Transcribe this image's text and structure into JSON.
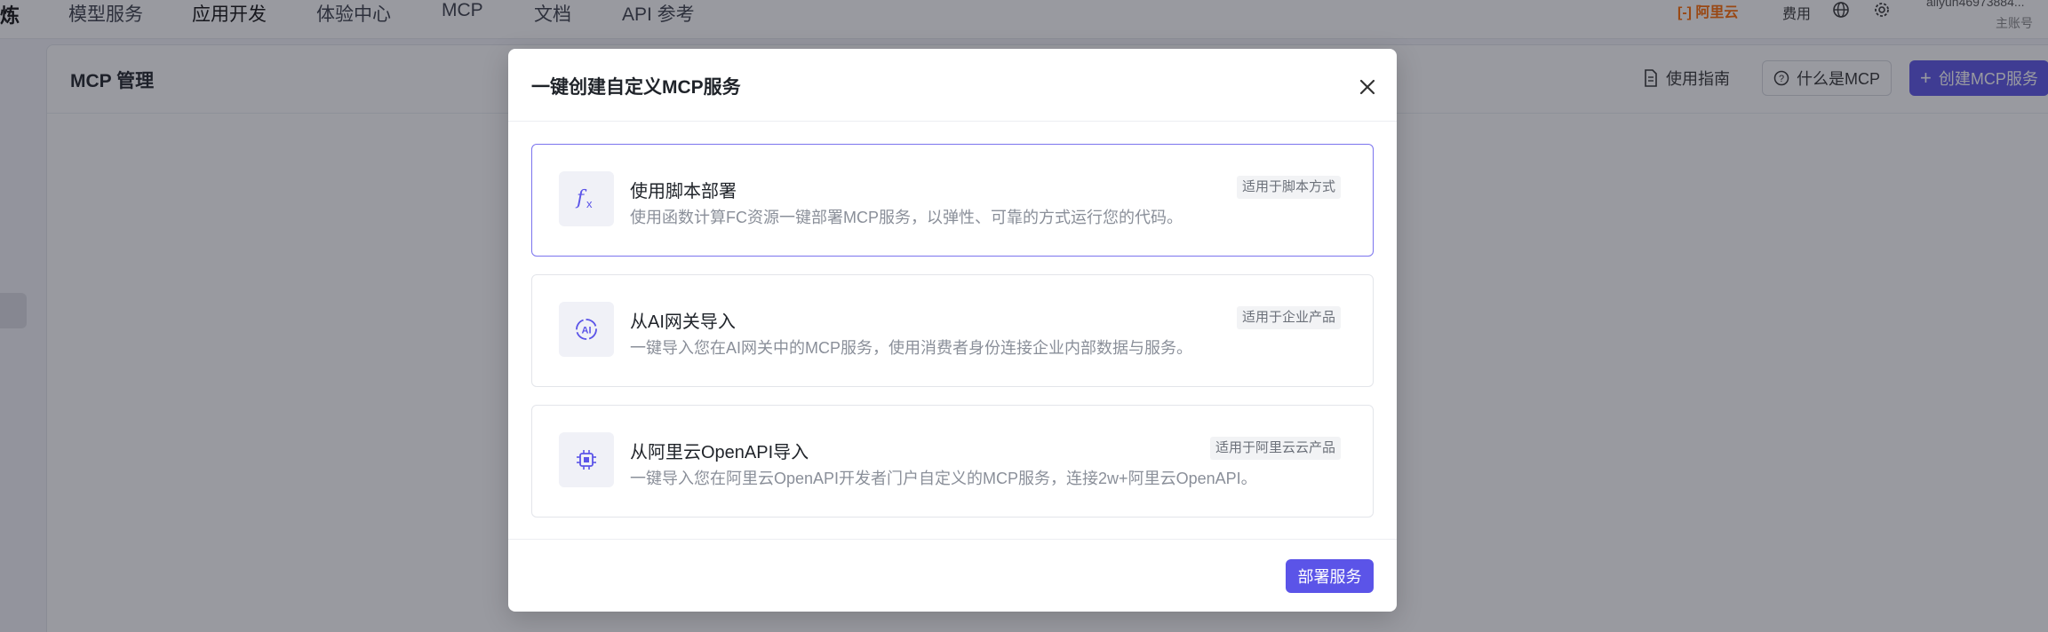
{
  "topnav": {
    "brand": "炼",
    "items": [
      "模型服务",
      "应用开发",
      "体验中心",
      "MCP",
      "文档",
      "API 参考"
    ],
    "logo": "[-] 阿里云",
    "fee": "费用",
    "account": "aliyun46973884...",
    "account_sub": "主账号"
  },
  "page": {
    "title": "MCP 管理",
    "guide_button": "使用指南",
    "what_is_mcp_button": "什么是MCP",
    "create_button": "创建MCP服务"
  },
  "modal": {
    "title": "一键创建自定义MCP服务",
    "options": [
      {
        "title": "使用脚本部署",
        "desc": "使用函数计算FC资源一键部署MCP服务，以弹性、可靠的方式运行您的代码。",
        "tag": "适用于脚本方式",
        "icon": "function-icon",
        "selected": true
      },
      {
        "title": "从AI网关导入",
        "desc": "一键导入您在AI网关中的MCP服务，使用消费者身份连接企业内部数据与服务。",
        "tag": "适用于企业产品",
        "icon": "ai-gateway-icon",
        "selected": false
      },
      {
        "title": "从阿里云OpenAPI导入",
        "desc": "一键导入您在阿里云OpenAPI开发者门户自定义的MCP服务，连接2w+阿里云OpenAPI。",
        "tag": "适用于阿里云云产品",
        "icon": "chip-icon",
        "selected": false
      }
    ],
    "deploy_button": "部署服务"
  },
  "colors": {
    "accent": "#5b54e8",
    "selected_border": "#7b74ee",
    "logo": "#ff6a00"
  }
}
